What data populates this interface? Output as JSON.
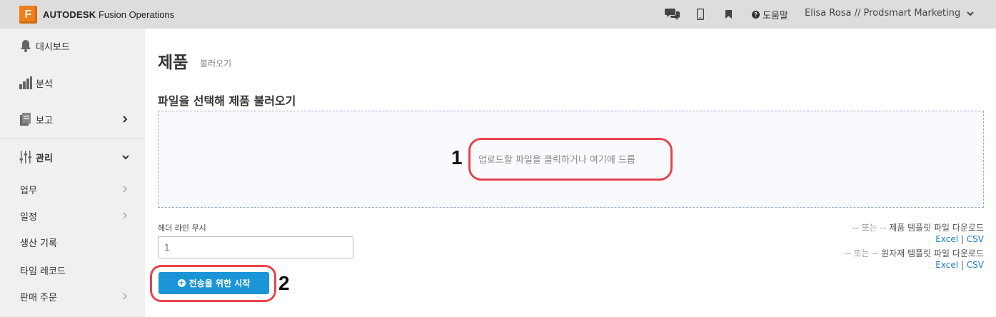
{
  "app": {
    "brand_bold": "AUTODESK",
    "brand_rest": "Fusion Operations",
    "logo_letter": "F"
  },
  "topbar": {
    "help_label": "도움말",
    "user_label": "Elisa Rosa // Prodsmart Marketing"
  },
  "sidebar": {
    "items": [
      {
        "label": "대시보드",
        "icon": "bell-icon"
      },
      {
        "label": "분석",
        "icon": "bar-chart-icon"
      },
      {
        "label": "보고",
        "icon": "report-icon"
      },
      {
        "label": "관리",
        "icon": "sliders-icon"
      }
    ],
    "sub_items": [
      {
        "label": "업무"
      },
      {
        "label": "일정"
      },
      {
        "label": "생산 기록"
      },
      {
        "label": "타임 레코드"
      },
      {
        "label": "판매 주문"
      }
    ]
  },
  "page": {
    "title": "제품",
    "subtitle": "불러오기",
    "section_title": "파일을 선택해 제품 불러오기",
    "dropzone_text": "업로드할 파일을 클릭하거나 여기에 드롭",
    "header_ignore_label": "헤더 라인 무시",
    "header_ignore_placeholder": "1",
    "start_button": "전송을 위한 시작",
    "product_template": {
      "prefix": "-- 또는 --",
      "label": "제품 템플릿 파일 다운로드",
      "excel": "Excel",
      "sep": "|",
      "csv": "CSV"
    },
    "material_template": {
      "prefix": "-- 또는 --",
      "label": "원자재 템플릿 파일 다운로드",
      "excel": "Excel",
      "sep": "|",
      "csv": "CSV"
    }
  },
  "annotations": {
    "num1": "1",
    "num2": "2",
    "color": "#e8444d"
  },
  "colors": {
    "brand_orange": "#f07f1a",
    "primary_button": "#1b95d8",
    "link": "#1b7fc4"
  }
}
